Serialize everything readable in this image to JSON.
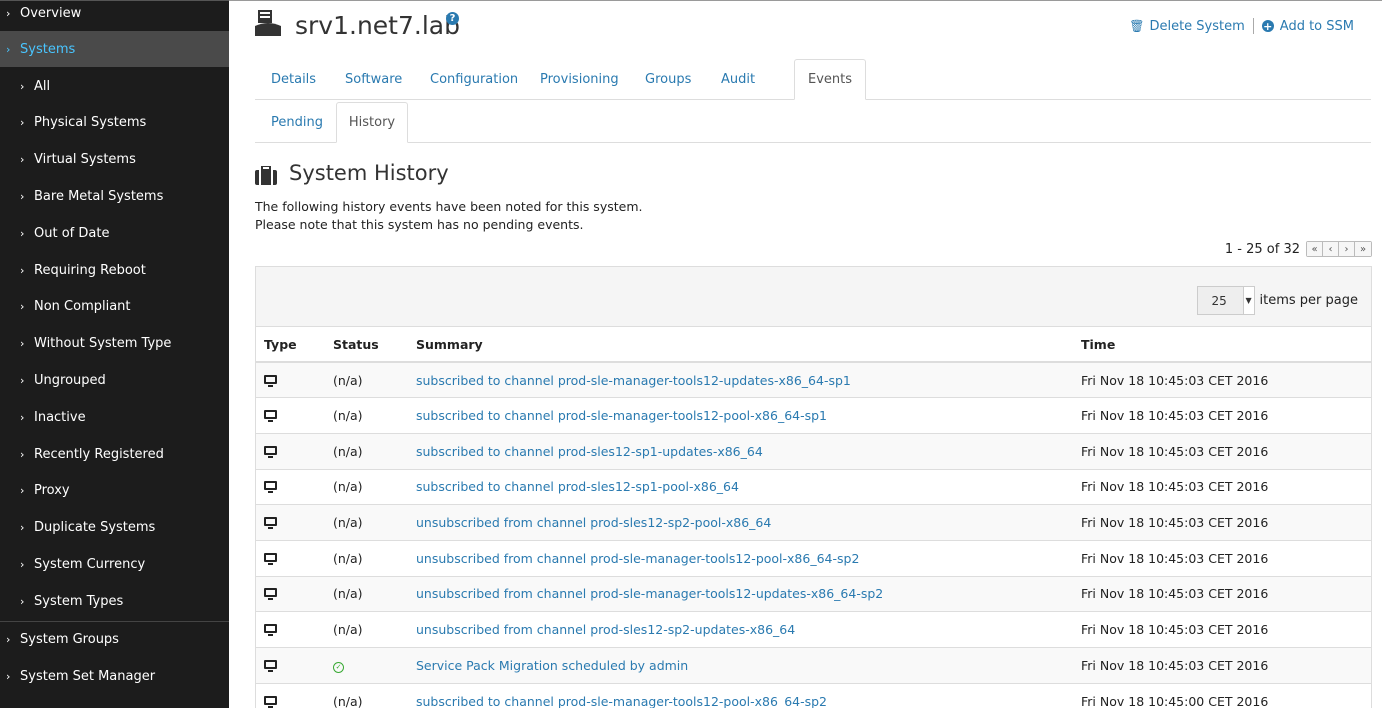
{
  "sidebar": {
    "overview": "Overview",
    "systems": "Systems",
    "sub_items": [
      "All",
      "Physical Systems",
      "Virtual Systems",
      "Bare Metal Systems",
      "Out of Date",
      "Requiring Reboot",
      "Non Compliant",
      "Without System Type",
      "Ungrouped",
      "Inactive",
      "Recently Registered",
      "Proxy",
      "Duplicate Systems",
      "System Currency",
      "System Types"
    ],
    "system_groups": "System Groups",
    "system_set_manager": "System Set Manager"
  },
  "header": {
    "title": "srv1.net7.lab",
    "delete_label": "Delete System",
    "add_ssm_label": "Add to SSM"
  },
  "tabs": [
    "Details",
    "Software",
    "Configuration",
    "Provisioning",
    "Groups",
    "Audit",
    "Events"
  ],
  "active_tab": "Events",
  "subtabs": [
    "Pending",
    "History"
  ],
  "active_subtab": "History",
  "section": {
    "title": "System History",
    "line1": "The following history events have been noted for this system.",
    "line2": "Please note that this system has no pending events."
  },
  "pager": {
    "range": "1 - 25 of 32"
  },
  "items_per_page": {
    "value": "25",
    "label": "items per page"
  },
  "table": {
    "headers": [
      "Type",
      "Status",
      "Summary",
      "Time"
    ],
    "rows": [
      {
        "status": "(n/a)",
        "summary": "subscribed to channel prod-sle-manager-tools12-updates-x86_64-sp1",
        "time": "Fri Nov 18 10:45:03 CET 2016"
      },
      {
        "status": "(n/a)",
        "summary": "subscribed to channel prod-sle-manager-tools12-pool-x86_64-sp1",
        "time": "Fri Nov 18 10:45:03 CET 2016"
      },
      {
        "status": "(n/a)",
        "summary": "subscribed to channel prod-sles12-sp1-updates-x86_64",
        "time": "Fri Nov 18 10:45:03 CET 2016"
      },
      {
        "status": "(n/a)",
        "summary": "subscribed to channel prod-sles12-sp1-pool-x86_64",
        "time": "Fri Nov 18 10:45:03 CET 2016"
      },
      {
        "status": "(n/a)",
        "summary": "unsubscribed from channel prod-sles12-sp2-pool-x86_64",
        "time": "Fri Nov 18 10:45:03 CET 2016"
      },
      {
        "status": "(n/a)",
        "summary": "unsubscribed from channel prod-sle-manager-tools12-pool-x86_64-sp2",
        "time": "Fri Nov 18 10:45:03 CET 2016"
      },
      {
        "status": "(n/a)",
        "summary": "unsubscribed from channel prod-sle-manager-tools12-updates-x86_64-sp2",
        "time": "Fri Nov 18 10:45:03 CET 2016"
      },
      {
        "status": "(n/a)",
        "summary": "unsubscribed from channel prod-sles12-sp2-updates-x86_64",
        "time": "Fri Nov 18 10:45:03 CET 2016"
      },
      {
        "status": "",
        "status_icon": "check-circle-icon",
        "summary": "Service Pack Migration scheduled by admin",
        "time": "Fri Nov 18 10:45:03 CET 2016"
      },
      {
        "status": "(n/a)",
        "summary": "subscribed to channel prod-sle-manager-tools12-pool-x86_64-sp2",
        "time": "Fri Nov 18 10:45:00 CET 2016"
      }
    ]
  },
  "colors": {
    "sidebar_bg": "#1c1c1c",
    "active_item_bg": "#4a4a4a",
    "active_item_text": "#49c5ff",
    "link": "#2a7ab0",
    "success": "#3aaa35"
  }
}
